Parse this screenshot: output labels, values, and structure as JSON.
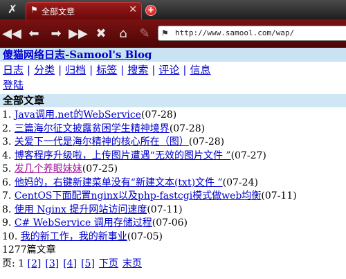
{
  "browser": {
    "tools_icon": "tools-icon",
    "tab": {
      "title": "全部文章",
      "close": "✕"
    },
    "newtab": "+",
    "url": "http://www.samool.com/wap/"
  },
  "page": {
    "header": "傻猫网络日志-Samool's Blog",
    "nav": [
      "日志",
      "分类",
      "归档",
      "标签",
      "搜索",
      "评论",
      "信息"
    ],
    "nav_sep": "|",
    "login": "登陆",
    "section_title": "全部文章",
    "articles": [
      {
        "num": "1.",
        "title": "Java调用.net的WebService",
        "date": "(07-28)"
      },
      {
        "num": "2.",
        "title": "三篇海尔征文披露贫困学生精神境界",
        "date": "(07-28)"
      },
      {
        "num": "3.",
        "title": "关爱下一代是海尔精神的核心所在（图）",
        "date": "(07-28)"
      },
      {
        "num": "4.",
        "title": "博客程序升级啦，上传图片遭遇“无效的图片文件 ”",
        "date": "(07-27)"
      },
      {
        "num": "5.",
        "title": "发几个养眼妹妹",
        "date": "(07-25)"
      },
      {
        "num": "6.",
        "title": "他妈的，右键新建菜单没有“新建文本(txt)文件 ”",
        "date": "(07-24)"
      },
      {
        "num": "7.",
        "title": "CentOS下面配置nginx以及php-fastcgi模式做web均衡",
        "date": "(07-11)"
      },
      {
        "num": "8.",
        "title": "使用 Nginx 提升网站访问速度",
        "date": "(07-11)"
      },
      {
        "num": "9.",
        "title": "C# WebService 调用存储过程",
        "date": "(07-06)"
      },
      {
        "num": "10.",
        "title": "我的新工作，我的新事业",
        "date": "(07-05)"
      }
    ],
    "count": "1277篇文章",
    "pager": {
      "label": "页: ",
      "current": "1",
      "pages": [
        "[2]",
        "[3]",
        "[4]",
        "[5]"
      ],
      "next": "下页",
      "last": "末页"
    }
  }
}
